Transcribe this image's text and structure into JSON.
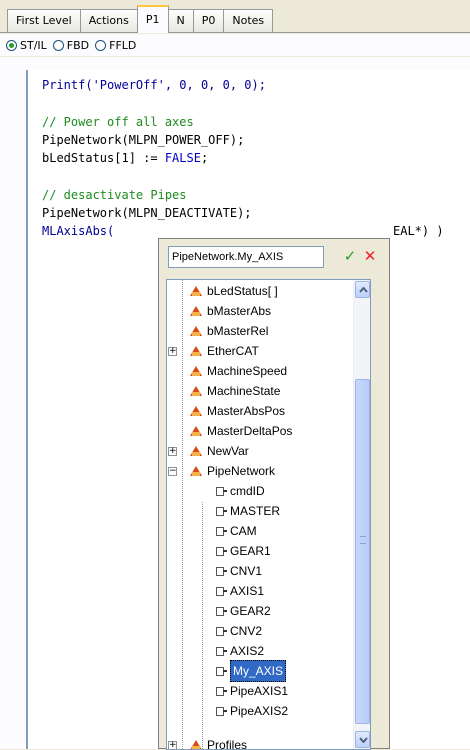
{
  "tabs": [
    {
      "label": "First Level"
    },
    {
      "label": "Actions"
    },
    {
      "label": "P1"
    },
    {
      "label": "N"
    },
    {
      "label": "P0"
    },
    {
      "label": "Notes"
    }
  ],
  "active_tab": "P1",
  "languages": [
    {
      "label": "ST/IL",
      "selected": true
    },
    {
      "label": "FBD",
      "selected": false
    },
    {
      "label": "FFLD",
      "selected": false
    }
  ],
  "code": {
    "line1": "Printf('PowerOff', 0, 0, 0, 0);",
    "comment1": "// Power off all axes",
    "line3": "PipeNetwork(MLPN_POWER_OFF);",
    "line4a": "bLedStatus[1] := ",
    "line4b": "FALSE",
    "line4c": ";",
    "comment2": "// desactivate Pipes",
    "line6": "PipeNetwork(MLPN_DEACTIVATE);",
    "line7a": "MLAxisAbs(",
    "line7b": "EAL*) )"
  },
  "autocomplete": {
    "input_value": "PipeNetwork.My_AXIS",
    "ok_symbol": "✓",
    "cancel_symbol": "✕",
    "variables": [
      {
        "label": "bLedStatus[ ]",
        "expandable": false
      },
      {
        "label": "bMasterAbs",
        "expandable": false
      },
      {
        "label": "bMasterRel",
        "expandable": false
      },
      {
        "label": "EtherCAT",
        "expandable": true
      },
      {
        "label": "MachineSpeed",
        "expandable": false
      },
      {
        "label": "MachineState",
        "expandable": false
      },
      {
        "label": "MasterAbsPos",
        "expandable": false
      },
      {
        "label": "MasterDeltaPos",
        "expandable": false
      },
      {
        "label": "NewVar",
        "expandable": true
      },
      {
        "label": "PipeNetwork",
        "expandable": true,
        "expanded": true
      }
    ],
    "subitems": [
      {
        "label": "cmdID"
      },
      {
        "label": "MASTER"
      },
      {
        "label": "CAM"
      },
      {
        "label": "GEAR1"
      },
      {
        "label": "CNV1"
      },
      {
        "label": "AXIS1"
      },
      {
        "label": "GEAR2"
      },
      {
        "label": "CNV2"
      },
      {
        "label": "AXIS2"
      },
      {
        "label": "My_AXIS",
        "selected": true
      },
      {
        "label": "PipeAXIS1"
      },
      {
        "label": "PipeAXIS2"
      }
    ],
    "partial_item": "Profiles"
  },
  "colors": {
    "keyword": "#0000cc",
    "comment": "#1e8b1e",
    "selection": "#316ac5"
  }
}
